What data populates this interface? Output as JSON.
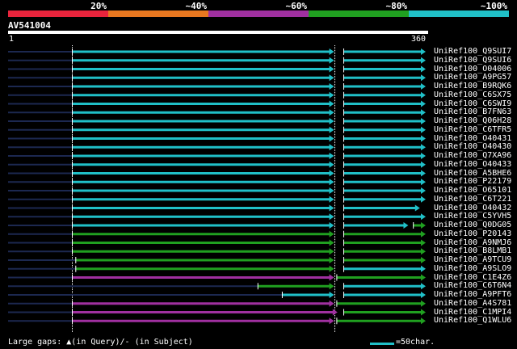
{
  "legend": {
    "segments": [
      {
        "label": "20%",
        "color": "#e8243c"
      },
      {
        "label": "~40%",
        "color": "#e87820"
      },
      {
        "label": "~60%",
        "color": "#a030a0"
      },
      {
        "label": "~80%",
        "color": "#20a020"
      },
      {
        "label": "~100%",
        "color": "#20c0c8"
      }
    ]
  },
  "query": {
    "id": "AV541004",
    "start_label": "1",
    "end_label": "360",
    "length": 360
  },
  "colors": {
    "cyan": "#20c0c8",
    "green": "#20a020",
    "magenta": "#a030a0",
    "unaligned": "#1c2850",
    "dotted_line": "#ffffff"
  },
  "hits": [
    {
      "id": "UniRef100_Q9SUI7",
      "segments": [
        {
          "start": 55,
          "end": 281,
          "color": "cyan"
        },
        {
          "start": 289,
          "end": 360,
          "color": "cyan"
        }
      ]
    },
    {
      "id": "UniRef100_Q9SUI6",
      "segments": [
        {
          "start": 55,
          "end": 281,
          "color": "cyan"
        },
        {
          "start": 289,
          "end": 360,
          "color": "cyan"
        }
      ]
    },
    {
      "id": "UniRef100_O04006",
      "segments": [
        {
          "start": 55,
          "end": 281,
          "color": "cyan"
        },
        {
          "start": 289,
          "end": 360,
          "color": "cyan"
        }
      ]
    },
    {
      "id": "UniRef100_A9PG57",
      "segments": [
        {
          "start": 55,
          "end": 281,
          "color": "cyan"
        },
        {
          "start": 289,
          "end": 360,
          "color": "cyan"
        }
      ]
    },
    {
      "id": "UniRef100_B9RQK6",
      "segments": [
        {
          "start": 55,
          "end": 281,
          "color": "cyan"
        },
        {
          "start": 289,
          "end": 360,
          "color": "cyan"
        }
      ]
    },
    {
      "id": "UniRef100_C6SX75",
      "segments": [
        {
          "start": 55,
          "end": 281,
          "color": "cyan"
        },
        {
          "start": 289,
          "end": 360,
          "color": "cyan"
        }
      ]
    },
    {
      "id": "UniRef100_C6SWI9",
      "segments": [
        {
          "start": 55,
          "end": 281,
          "color": "cyan"
        },
        {
          "start": 289,
          "end": 360,
          "color": "cyan"
        }
      ]
    },
    {
      "id": "UniRef100_B7FN63",
      "segments": [
        {
          "start": 55,
          "end": 281,
          "color": "cyan"
        },
        {
          "start": 289,
          "end": 360,
          "color": "cyan"
        }
      ]
    },
    {
      "id": "UniRef100_Q06H28",
      "segments": [
        {
          "start": 55,
          "end": 281,
          "color": "cyan"
        },
        {
          "start": 289,
          "end": 360,
          "color": "cyan"
        }
      ]
    },
    {
      "id": "UniRef100_C6TFR5",
      "segments": [
        {
          "start": 55,
          "end": 281,
          "color": "cyan"
        },
        {
          "start": 289,
          "end": 360,
          "color": "cyan"
        }
      ]
    },
    {
      "id": "UniRef100_O40431",
      "segments": [
        {
          "start": 55,
          "end": 281,
          "color": "cyan"
        },
        {
          "start": 289,
          "end": 360,
          "color": "cyan"
        }
      ]
    },
    {
      "id": "UniRef100_O40430",
      "segments": [
        {
          "start": 55,
          "end": 281,
          "color": "cyan"
        },
        {
          "start": 289,
          "end": 360,
          "color": "cyan"
        }
      ]
    },
    {
      "id": "UniRef100_Q7XA96",
      "segments": [
        {
          "start": 55,
          "end": 281,
          "color": "cyan"
        },
        {
          "start": 289,
          "end": 360,
          "color": "cyan"
        }
      ]
    },
    {
      "id": "UniRef100_O40433",
      "segments": [
        {
          "start": 55,
          "end": 281,
          "color": "cyan"
        },
        {
          "start": 289,
          "end": 360,
          "color": "cyan"
        }
      ]
    },
    {
      "id": "UniRef100_A5BHE6",
      "segments": [
        {
          "start": 55,
          "end": 281,
          "color": "cyan"
        },
        {
          "start": 289,
          "end": 360,
          "color": "cyan"
        }
      ]
    },
    {
      "id": "UniRef100_P22179",
      "segments": [
        {
          "start": 55,
          "end": 281,
          "color": "cyan"
        },
        {
          "start": 289,
          "end": 360,
          "color": "cyan"
        }
      ]
    },
    {
      "id": "UniRef100_O65101",
      "segments": [
        {
          "start": 55,
          "end": 281,
          "color": "cyan"
        },
        {
          "start": 289,
          "end": 360,
          "color": "cyan"
        }
      ]
    },
    {
      "id": "UniRef100_C6T221",
      "segments": [
        {
          "start": 55,
          "end": 281,
          "color": "cyan"
        },
        {
          "start": 289,
          "end": 360,
          "color": "cyan"
        }
      ]
    },
    {
      "id": "UniRef100_O40432",
      "segments": [
        {
          "start": 55,
          "end": 281,
          "color": "cyan"
        },
        {
          "start": 289,
          "end": 355,
          "color": "cyan"
        }
      ]
    },
    {
      "id": "UniRef100_C5YVH5",
      "segments": [
        {
          "start": 55,
          "end": 281,
          "color": "cyan"
        },
        {
          "start": 289,
          "end": 360,
          "color": "cyan"
        }
      ]
    },
    {
      "id": "UniRef100_Q0DG05",
      "segments": [
        {
          "start": 55,
          "end": 281,
          "color": "cyan"
        },
        {
          "start": 289,
          "end": 345,
          "color": "cyan"
        },
        {
          "start": 349,
          "end": 360,
          "color": "green"
        }
      ]
    },
    {
      "id": "UniRef100_P20143",
      "segments": [
        {
          "start": 55,
          "end": 281,
          "color": "green"
        },
        {
          "start": 289,
          "end": 360,
          "color": "green"
        }
      ]
    },
    {
      "id": "UniRef100_A9NMJ6",
      "segments": [
        {
          "start": 55,
          "end": 281,
          "color": "green"
        },
        {
          "start": 289,
          "end": 360,
          "color": "green"
        }
      ]
    },
    {
      "id": "UniRef100_B8LMB1",
      "segments": [
        {
          "start": 55,
          "end": 281,
          "color": "green"
        },
        {
          "start": 289,
          "end": 360,
          "color": "green"
        }
      ]
    },
    {
      "id": "UniRef100_A9TCU9",
      "segments": [
        {
          "start": 58,
          "end": 281,
          "color": "green"
        },
        {
          "start": 289,
          "end": 360,
          "color": "green"
        }
      ]
    },
    {
      "id": "UniRef100_A9SLO9",
      "segments": [
        {
          "start": 58,
          "end": 281,
          "color": "green"
        },
        {
          "start": 289,
          "end": 360,
          "color": "cyan"
        }
      ]
    },
    {
      "id": "UniRef100_C1E4Z6",
      "segments": [
        {
          "start": 55,
          "end": 281,
          "color": "magenta"
        },
        {
          "start": 283,
          "end": 360,
          "color": "green"
        }
      ]
    },
    {
      "id": "UniRef100_C6T6N4",
      "segments": [
        {
          "start": 215,
          "end": 281,
          "color": "green"
        },
        {
          "start": 289,
          "end": 360,
          "color": "cyan"
        }
      ]
    },
    {
      "id": "UniRef100_A9PFT6",
      "segments": [
        {
          "start": 236,
          "end": 281,
          "color": "cyan"
        },
        {
          "start": 289,
          "end": 360,
          "color": "cyan"
        }
      ]
    },
    {
      "id": "UniRef100_A4S781",
      "segments": [
        {
          "start": 55,
          "end": 281,
          "color": "magenta"
        },
        {
          "start": 283,
          "end": 360,
          "color": "green"
        }
      ]
    },
    {
      "id": "UniRef100_C1MPI4",
      "segments": [
        {
          "start": 55,
          "end": 284,
          "color": "magenta"
        },
        {
          "start": 289,
          "end": 360,
          "color": "green"
        }
      ]
    },
    {
      "id": "UniRef100_Q1WLU6",
      "segments": [
        {
          "start": 55,
          "end": 281,
          "color": "magenta"
        },
        {
          "start": 283,
          "end": 360,
          "color": "green"
        }
      ]
    }
  ],
  "footer": {
    "gaps_label": "Large gaps:",
    "gaps_in_query": "(in Query)/",
    "gaps_in_subject": "- (in Subject)",
    "scale_label": "=50char."
  }
}
